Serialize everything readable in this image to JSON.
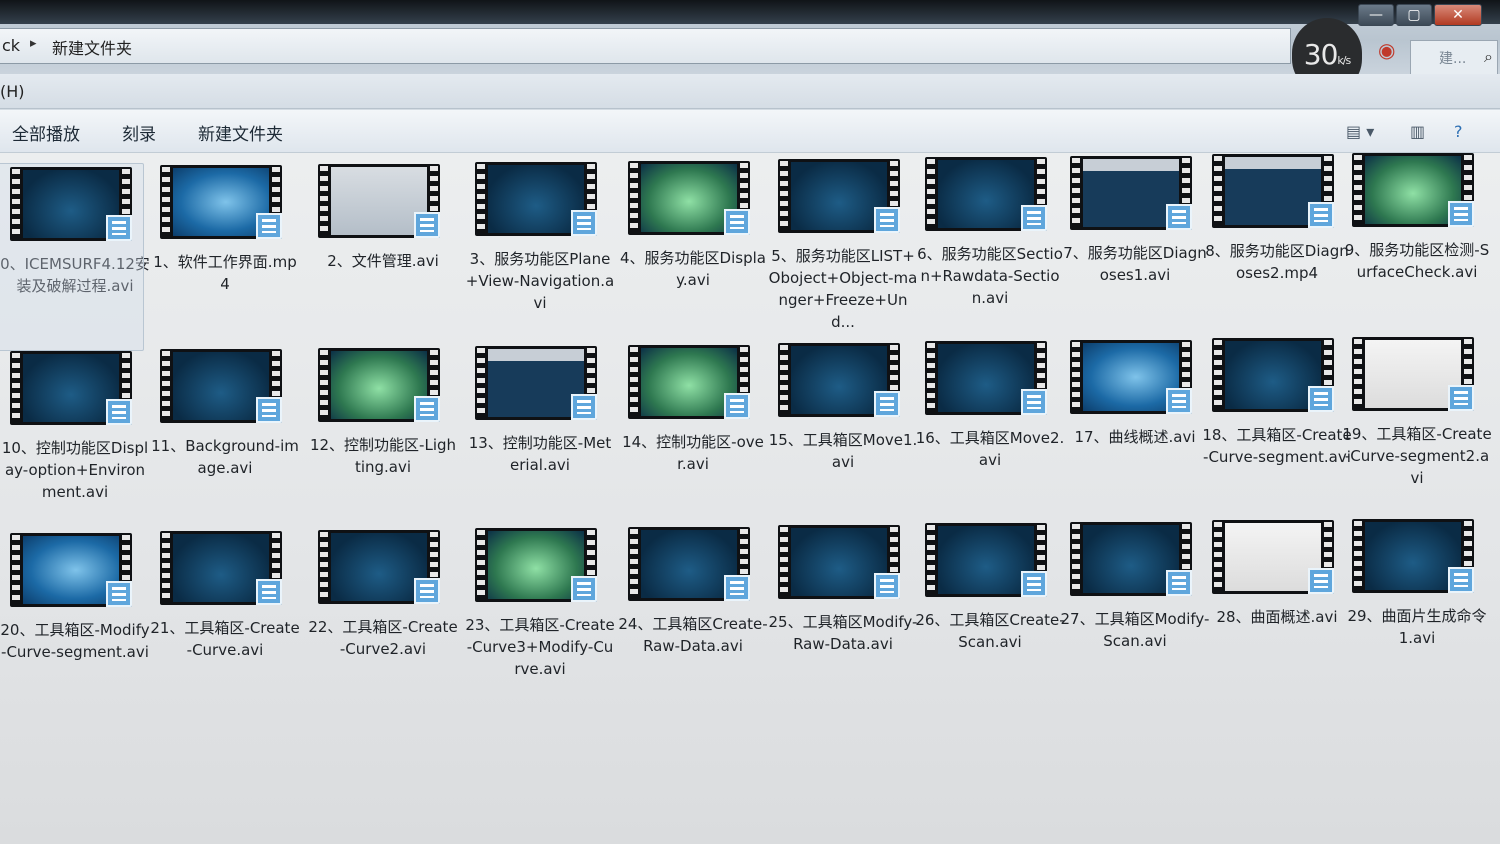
{
  "window": {
    "minimize": "—",
    "maximize": "▢",
    "close": "✕"
  },
  "address": {
    "prefix": "ck",
    "separator": "▸",
    "current": "新建文件夹"
  },
  "search": {
    "placeholder": "建..."
  },
  "overlay": {
    "speed_value": "30",
    "speed_unit": "k/s"
  },
  "menu": {
    "text": "(H)"
  },
  "toolbar": {
    "play_all": "全部播放",
    "burn": "刻录",
    "new_folder": "新建文件夹"
  },
  "files": [
    {
      "name": "0、ICEMSURF4.12安装及破解过程.avi",
      "thumb": "dark"
    },
    {
      "name": "1、软件工作界面.mp4",
      "thumb": "win7"
    },
    {
      "name": "2、文件管理.avi",
      "thumb": "light"
    },
    {
      "name": "3、服务功能区Plane+View-Navigation.avi",
      "thumb": "dark"
    },
    {
      "name": "4、服务功能区Display.avi",
      "thumb": "green"
    },
    {
      "name": "5、服务功能区LIST+Oboject+Object-manger+Freeze+Und...",
      "thumb": "dark"
    },
    {
      "name": "6、服务功能区Section+Rawdata-Section.avi",
      "thumb": "dark"
    },
    {
      "name": "7、服务功能区Diagnoses1.avi",
      "thumb": "app"
    },
    {
      "name": "8、服务功能区Diagnoses2.mp4",
      "thumb": "app"
    },
    {
      "name": "9、服务功能区检测-SurfaceCheck.avi",
      "thumb": "green"
    },
    {
      "name": "10、控制功能区Display-option+Environment.avi",
      "thumb": "dark"
    },
    {
      "name": "11、Background-image.avi",
      "thumb": "dark"
    },
    {
      "name": "12、控制功能区-Lighting.avi",
      "thumb": "green"
    },
    {
      "name": "13、控制功能区-Meterial.avi",
      "thumb": "app"
    },
    {
      "name": "14、控制功能区-over.avi",
      "thumb": "green"
    },
    {
      "name": "15、工具箱区Move1.avi",
      "thumb": "dark"
    },
    {
      "name": "16、工具箱区Move2.avi",
      "thumb": "dark"
    },
    {
      "name": "17、曲线概述.avi",
      "thumb": "win7"
    },
    {
      "name": "18、工具箱区-Create-Curve-segment.avi",
      "thumb": "dark"
    },
    {
      "name": "19、工具箱区-Create-Curve-segment2.avi",
      "thumb": "white"
    },
    {
      "name": "20、工具箱区-Modify-Curve-segment.avi",
      "thumb": "win7"
    },
    {
      "name": "21、工具箱区-Create-Curve.avi",
      "thumb": "dark"
    },
    {
      "name": "22、工具箱区-Create-Curve2.avi",
      "thumb": "dark"
    },
    {
      "name": "23、工具箱区-Create-Curve3+Modify-Curve.avi",
      "thumb": "green"
    },
    {
      "name": "24、工具箱区Create-Raw-Data.avi",
      "thumb": "dark"
    },
    {
      "name": "25、工具箱区Modify-Raw-Data.avi",
      "thumb": "dark"
    },
    {
      "name": "26、工具箱区Create-Scan.avi",
      "thumb": "dark"
    },
    {
      "name": "27、工具箱区Modify-Scan.avi",
      "thumb": "dark"
    },
    {
      "name": "28、曲面概述.avi",
      "thumb": "white"
    },
    {
      "name": "29、曲面片生成命令1.avi",
      "thumb": "dark"
    }
  ]
}
